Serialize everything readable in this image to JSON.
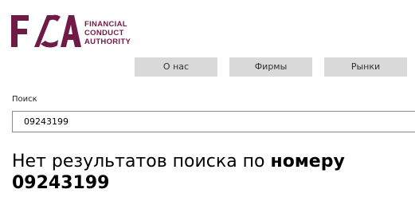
{
  "brand": {
    "logo_letters": "FCA",
    "name_lines": [
      "FINANCIAL",
      "CONDUCT",
      "AUTHORITY"
    ],
    "color": "#701b45"
  },
  "nav": {
    "items": [
      {
        "label": "О нас"
      },
      {
        "label": "Фирмы"
      },
      {
        "label": "Рынки"
      }
    ]
  },
  "search": {
    "label": "Поиск",
    "value": "09243199"
  },
  "result": {
    "prefix": "Нет результатов поиска по ",
    "emphasis": "номеру",
    "number": "09243199"
  }
}
